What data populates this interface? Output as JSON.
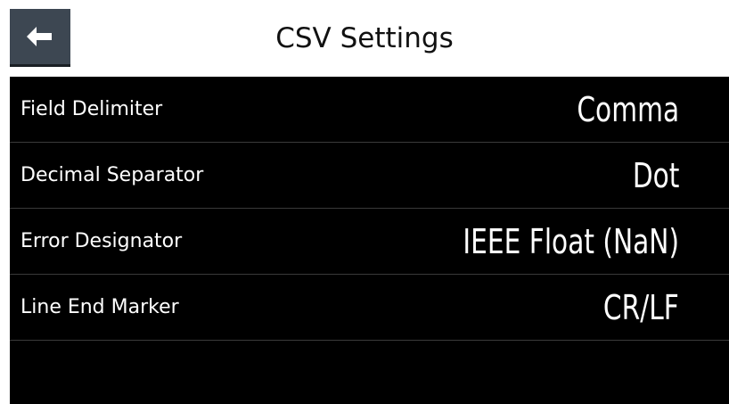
{
  "header": {
    "title": "CSV Settings",
    "back_icon": "back-arrow-icon"
  },
  "settings": [
    {
      "label": "Field Delimiter",
      "value": "Comma"
    },
    {
      "label": "Decimal Separator",
      "value": "Dot"
    },
    {
      "label": "Error Designator",
      "value": "IEEE Float (NaN)"
    },
    {
      "label": "Line End Marker",
      "value": "CR/LF"
    }
  ],
  "colors": {
    "background": "#000000",
    "back_button": "#3d4752",
    "text": "#ffffff"
  }
}
